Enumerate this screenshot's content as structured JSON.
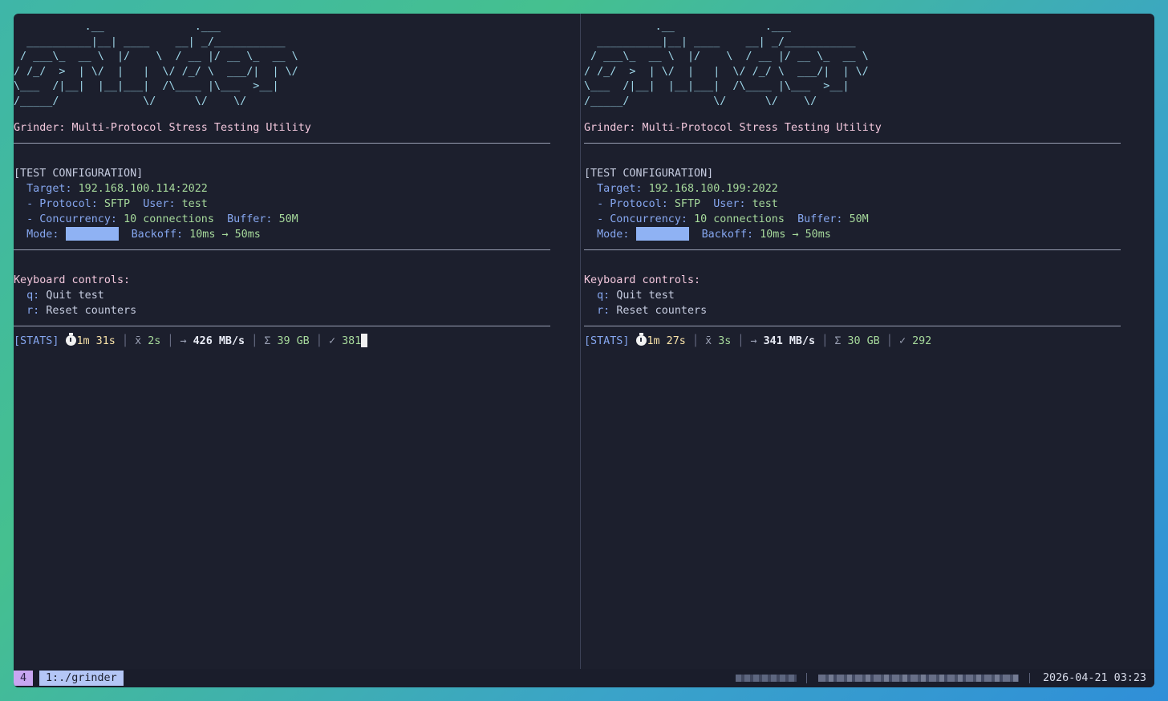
{
  "panes": [
    {
      "ascii_art": "           .__              .___\n  __________|__| ____    __| _/___________\n / ___\\_  __ \\  |/    \\  / __ |/ __ \\_  __ \\\n/ /_/  >  | \\/  |   |  \\/ /_/ \\  ___/|  | \\/\n\\___  /|__|  |__|___|  /\\____ |\\___  >__|\n/_____/             \\/      \\/    \\/",
      "title": "Grinder: Multi-Protocol Stress Testing Utility",
      "config_header": "[TEST CONFIGURATION]",
      "target_label": "Target:",
      "target_value": "192.168.100.114:2022",
      "protocol_label": "- Protocol:",
      "protocol_value": "SFTP",
      "user_label": "User:",
      "user_value": "test",
      "concurrency_label": "- Concurrency:",
      "concurrency_value": "10 connections",
      "buffer_label": "Buffer:",
      "buffer_value": "50M",
      "mode_label": "Mode:",
      "backoff_label": "Backoff:",
      "backoff_value": "10ms → 50ms",
      "keyboard_header": "Keyboard controls:",
      "controls": [
        {
          "key": "q:",
          "action": "Quit test"
        },
        {
          "key": "r:",
          "action": "Reset counters"
        }
      ],
      "stats_label": "[STATS]",
      "elapsed": "1m 31s",
      "avg_symbol": "x̄",
      "avg_value": "2s",
      "rate_arrow": "→",
      "rate_value": "426 MB/s",
      "total_symbol": "Σ",
      "total_value": "39 GB",
      "count_symbol": "✓",
      "count_value": "381"
    },
    {
      "ascii_art": "           .__              .___\n  __________|__| ____    __| _/___________\n / ___\\_  __ \\  |/    \\  / __ |/ __ \\_  __ \\\n/ /_/  >  | \\/  |   |  \\/ /_/ \\  ___/|  | \\/\n\\___  /|__|  |__|___|  /\\____ |\\___  >__|\n/_____/             \\/      \\/    \\/",
      "title": "Grinder: Multi-Protocol Stress Testing Utility",
      "config_header": "[TEST CONFIGURATION]",
      "target_label": "Target:",
      "target_value": "192.168.100.199:2022",
      "protocol_label": "- Protocol:",
      "protocol_value": "SFTP",
      "user_label": "User:",
      "user_value": "test",
      "concurrency_label": "- Concurrency:",
      "concurrency_value": "10 connections",
      "buffer_label": "Buffer:",
      "buffer_value": "50M",
      "mode_label": "Mode:",
      "backoff_label": "Backoff:",
      "backoff_value": "10ms → 50ms",
      "keyboard_header": "Keyboard controls:",
      "controls": [
        {
          "key": "q:",
          "action": "Quit test"
        },
        {
          "key": "r:",
          "action": "Reset counters"
        }
      ],
      "stats_label": "[STATS]",
      "elapsed": "1m 27s",
      "avg_symbol": "x̄",
      "avg_value": "3s",
      "rate_arrow": "→",
      "rate_value": "341 MB/s",
      "total_symbol": "Σ",
      "total_value": "30 GB",
      "count_symbol": "✓",
      "count_value": "292"
    }
  ],
  "statusbar": {
    "session_number": "4",
    "window_label": "1:./grinder",
    "datetime": "2026-04-21 03:23"
  },
  "colors": {
    "background": "#1c1f2d",
    "ascii": "#9ed6e8",
    "title": "#f2c7dc",
    "label_blue": "#86a7f0",
    "value_green": "#a6d99b",
    "mode_highlight": "#8fb2f4",
    "session_badge": "#c9a6f2",
    "window_tab": "#b4c6f6"
  }
}
